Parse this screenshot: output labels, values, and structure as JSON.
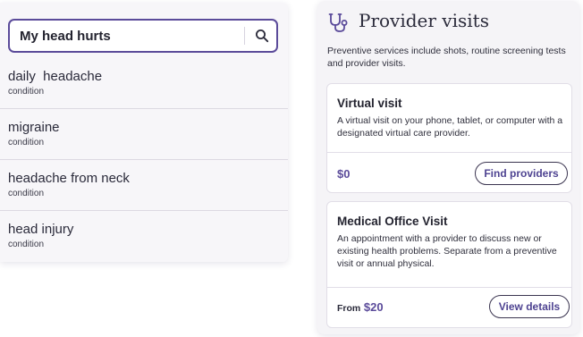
{
  "search": {
    "value": "My head hurts",
    "button_icon": "search-icon"
  },
  "results": [
    {
      "title": "daily  headache",
      "type": "condition"
    },
    {
      "title": "migraine",
      "type": "condition"
    },
    {
      "title": "headache from neck",
      "type": "condition"
    },
    {
      "title": "head injury",
      "type": "condition"
    }
  ],
  "provider": {
    "icon": "stethoscope-icon",
    "title": "Provider visits",
    "description": "Preventive services include shots, routine screening tests and provider visits.",
    "cards": [
      {
        "title": "Virtual visit",
        "body": "A virtual visit on your phone, tablet, or computer with a designated virtual care provider.",
        "price_prefix": "",
        "price": "$0",
        "button": "Find providers"
      },
      {
        "title": "Medical Office Visit",
        "body": "An appointment with a provider to discuss new or existing health problems. Separate from a preventive visit or annual physical.",
        "price_prefix": "From",
        "price": "$20",
        "button": "View details"
      }
    ]
  },
  "colors": {
    "accent": "#5b4b9a",
    "panel_bg": "#f5f4f7",
    "text": "#2a2a3a"
  }
}
